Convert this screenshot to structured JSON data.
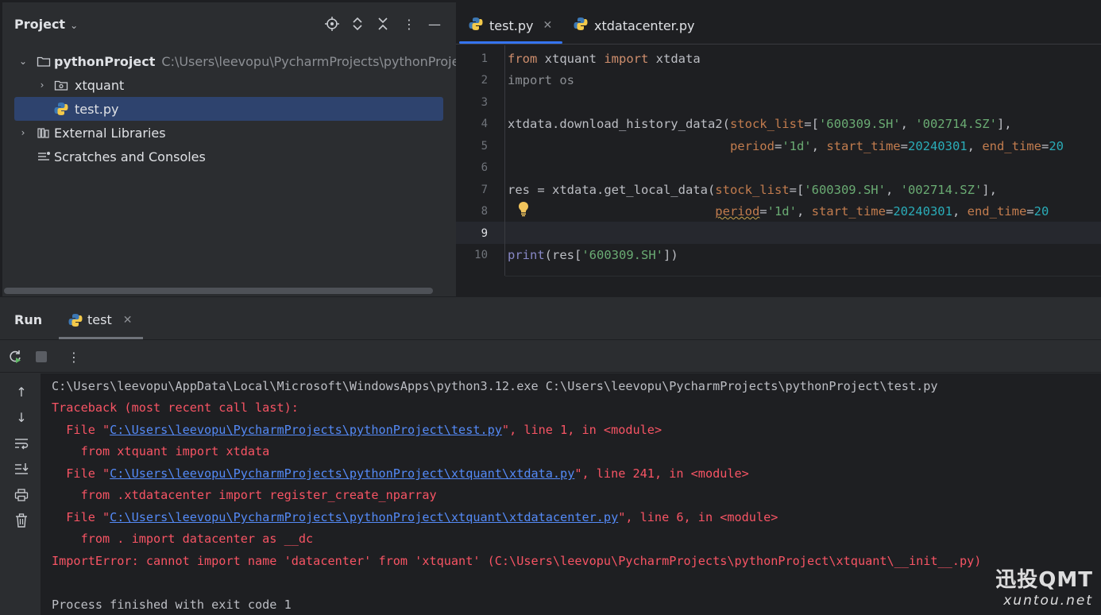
{
  "project": {
    "title": "Project",
    "tree": {
      "root_name": "pythonProject",
      "root_path": "C:\\Users\\leevopu\\PycharmProjects\\pythonProject",
      "folder": "xtquant",
      "file": "test.py",
      "external": "External Libraries",
      "scratches": "Scratches and Consoles"
    }
  },
  "editor": {
    "tabs": [
      {
        "label": "test.py",
        "active": true
      },
      {
        "label": "xtdatacenter.py",
        "active": false
      }
    ],
    "line_numbers": [
      "1",
      "2",
      "3",
      "4",
      "5",
      "6",
      "7",
      "8",
      "9",
      "10"
    ],
    "code": {
      "l1": {
        "kw1": "from",
        "mod": " xtquant ",
        "kw2": "import",
        "name": " xtdata"
      },
      "l2": "import os",
      "l4": {
        "call": "xtdata.download_history_data2(",
        "p1": "stock_list",
        "eq1": "=[",
        "s1": "'600309.SH'",
        "c1": ", ",
        "s2": "'002714.SZ'",
        "end": "],"
      },
      "l5": {
        "indent": "                              ",
        "p1": "period",
        "eq1": "=",
        "s1": "'1d'",
        "c1": ", ",
        "p2": "start_time",
        "eq2": "=",
        "n1": "20240301",
        "c2": ", ",
        "p3": "end_time",
        "eq3": "=",
        "n2": "20"
      },
      "l7": {
        "call": "res = xtdata.get_local_data(",
        "p1": "stock_list",
        "eq1": "=[",
        "s1": "'600309.SH'",
        "c1": ", ",
        "s2": "'002714.SZ'",
        "end": "],"
      },
      "l8": {
        "indent": "                            ",
        "p1": "period",
        "eq1": "=",
        "s1": "'1d'",
        "c1": ", ",
        "p2": "start_time",
        "eq2": "=",
        "n1": "20240301",
        "c2": ", ",
        "p3": "end_time",
        "eq3": "=",
        "n2": "20"
      },
      "l10": {
        "fn": "print",
        "open": "(res[",
        "s1": "'600309.SH'",
        "close": "])"
      }
    }
  },
  "run": {
    "title": "Run",
    "tab_label": "test",
    "console": {
      "cmd": "C:\\Users\\leevopu\\AppData\\Local\\Microsoft\\WindowsApps\\python3.12.exe C:\\Users\\leevopu\\PycharmProjects\\pythonProject\\test.py",
      "traceback": "Traceback (most recent call last):",
      "f1_pre": "  File \"",
      "f1_link": "C:\\Users\\leevopu\\PycharmProjects\\pythonProject\\test.py",
      "f1_post": "\", line 1, in <module>",
      "f1_code": "    from xtquant import xtdata",
      "f2_pre": "  File \"",
      "f2_link": "C:\\Users\\leevopu\\PycharmProjects\\pythonProject\\xtquant\\xtdata.py",
      "f2_post": "\", line 241, in <module>",
      "f2_code": "    from .xtdatacenter import register_create_nparray",
      "f3_pre": "  File \"",
      "f3_link": "C:\\Users\\leevopu\\PycharmProjects\\pythonProject\\xtquant\\xtdatacenter.py",
      "f3_post": "\", line 6, in <module>",
      "f3_code": "    from . import datacenter as __dc",
      "error": "ImportError: cannot import name 'datacenter' from 'xtquant' (C:\\Users\\leevopu\\PycharmProjects\\pythonProject\\xtquant\\__init__.py)",
      "exit": "Process finished with exit code 1"
    }
  },
  "watermark": {
    "main": "迅投QMT",
    "sub": "xuntou.net"
  },
  "colors": {
    "selection": "#2e436e",
    "error": "#f75464",
    "link": "#548af7",
    "accent": "#3574f0"
  }
}
